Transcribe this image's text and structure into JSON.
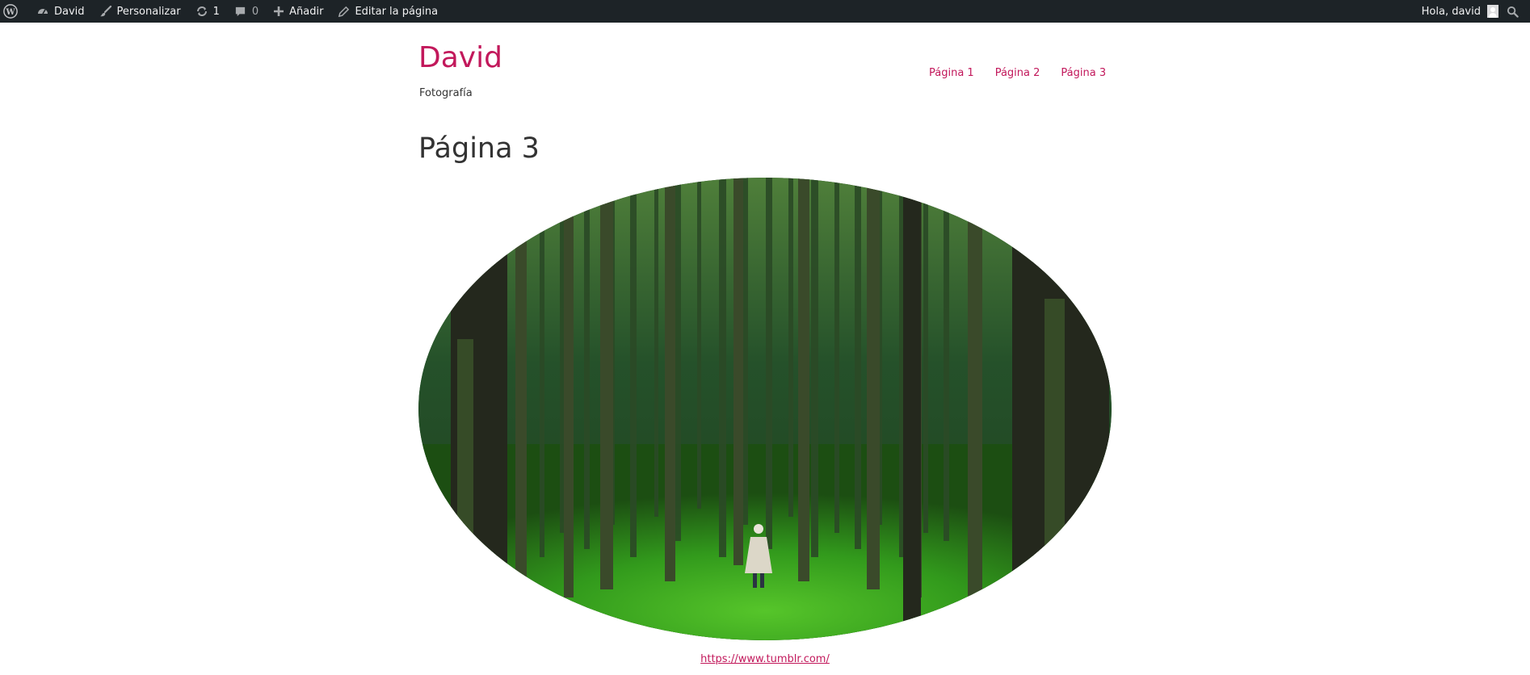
{
  "adminbar": {
    "site_name": "David",
    "customize": "Personalizar",
    "updates_count": "1",
    "comments_count": "0",
    "add_new": "Añadir",
    "edit_page": "Editar la página",
    "greeting": "Hola, david"
  },
  "header": {
    "site_title": "David",
    "tagline": "Fotografía"
  },
  "nav": {
    "items": [
      {
        "label": "Página 1"
      },
      {
        "label": "Página 2"
      },
      {
        "label": "Página 3"
      }
    ]
  },
  "main": {
    "title": "Página 3",
    "image_link": "https://www.tumblr.com/"
  },
  "colors": {
    "admin_bar": "#1d2327",
    "accent": "#c2185b",
    "forest": "#2f7a22"
  }
}
